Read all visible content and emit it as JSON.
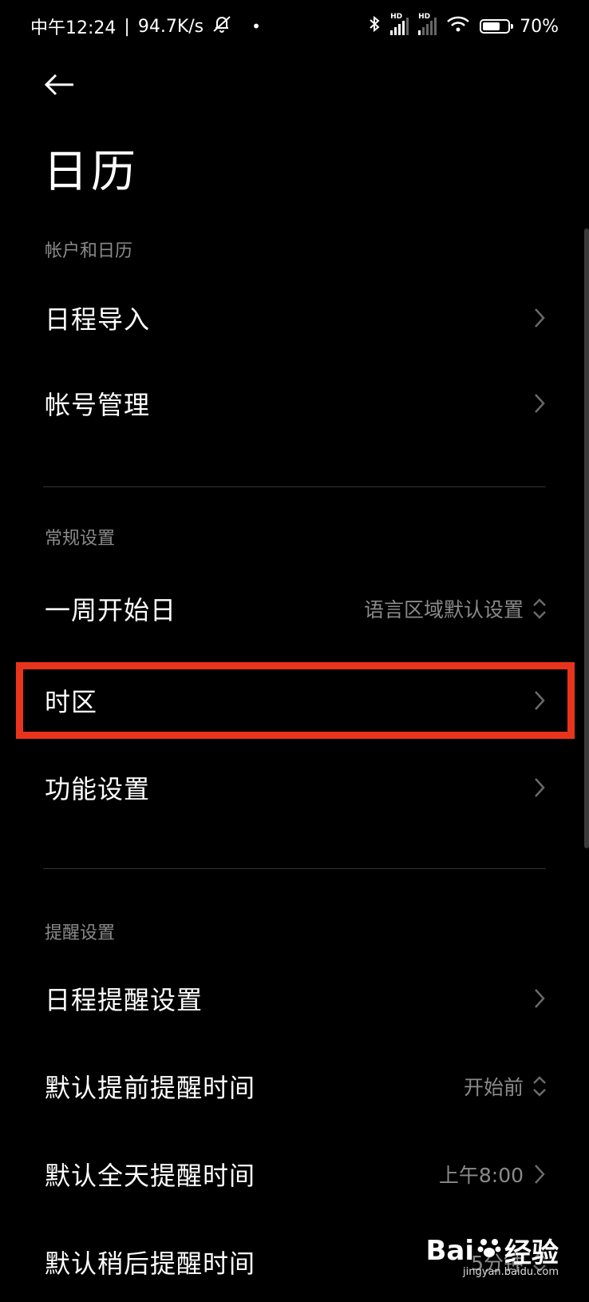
{
  "status_bar": {
    "time": "中午12:24",
    "separator": "|",
    "speed": "94.7K/s",
    "dot": "•",
    "hd": "HD",
    "battery": "70%",
    "battery_level": 0.7,
    "icons": [
      "mute-bell-icon",
      "bluetooth-icon",
      "signal-icon",
      "wifi-icon",
      "battery-icon"
    ]
  },
  "header": {
    "back_icon": "back-arrow-icon",
    "title": "日历"
  },
  "sections": [
    {
      "header": "帐户和日历",
      "items": [
        {
          "label": "日程导入",
          "value": "",
          "control": "chevron"
        },
        {
          "label": "帐号管理",
          "value": "",
          "control": "chevron"
        }
      ]
    },
    {
      "header": "常规设置",
      "items": [
        {
          "label": "一周开始日",
          "value": "语言区域默认设置",
          "control": "updown"
        },
        {
          "label": "时区",
          "value": "",
          "control": "chevron",
          "highlighted": true
        },
        {
          "label": "功能设置",
          "value": "",
          "control": "chevron"
        }
      ]
    },
    {
      "header": "提醒设置",
      "items": [
        {
          "label": "日程提醒设置",
          "value": "",
          "control": "chevron"
        },
        {
          "label": "默认提前提醒时间",
          "value": "开始前",
          "control": "updown"
        },
        {
          "label": "默认全天提醒时间",
          "value": "上午8:00",
          "control": "chevron"
        },
        {
          "label": "默认稍后提醒时间",
          "value": "5分钟",
          "control": "updown"
        }
      ]
    }
  ],
  "highlight_color": "#e8341c",
  "watermark": {
    "logo": "Bai",
    "text": "经验",
    "url": "jingyan.baidu.com"
  }
}
